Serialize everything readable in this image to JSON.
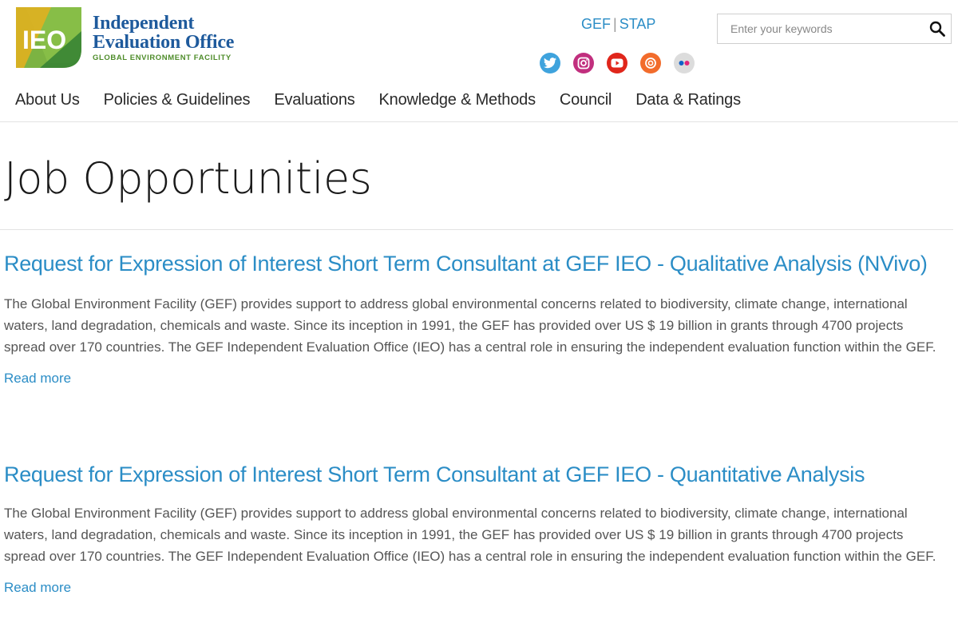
{
  "logo": {
    "mark_text": "IEO",
    "line1": "Independent",
    "line2": "Evaluation Office",
    "line3": "GLOBAL ENVIRONMENT FACILITY"
  },
  "top_links": {
    "gef": "GEF",
    "separator": "|",
    "stap": "STAP"
  },
  "social": [
    {
      "name": "twitter-icon",
      "color": "#3fa3dd"
    },
    {
      "name": "instagram-icon",
      "color": "#c12f7e"
    },
    {
      "name": "youtube-icon",
      "color": "#e0261b"
    },
    {
      "name": "issuu-icon",
      "color": "#f26c2c"
    },
    {
      "name": "flickr-icon",
      "color": "#dcdcdc"
    }
  ],
  "search": {
    "placeholder": "Enter your keywords",
    "value": ""
  },
  "nav": {
    "about": "About Us",
    "policies": "Policies & Guidelines",
    "evaluations": "Evaluations",
    "knowledge": "Knowledge & Methods",
    "council": "Council",
    "data": "Data & Ratings"
  },
  "page_title": "Job Opportunities",
  "articles": [
    {
      "title": "Request for Expression of Interest Short Term Consultant at GEF IEO - Qualitative Analysis (NVivo)",
      "body": "The Global Environment Facility (GEF) provides support to address global environmental concerns related to biodiversity, climate change, international waters, land degradation, chemicals and waste. Since its inception in 1991, the GEF has provided over US $ 19 billion in grants through 4700 projects spread over 170 countries. The GEF Independent Evaluation Office (IEO) has a central role in ensuring the independent evaluation function within the GEF.",
      "read_more": "Read more"
    },
    {
      "title": "Request for Expression of Interest Short Term Consultant at GEF IEO - Quantitative Analysis",
      "body": "The Global Environment Facility (GEF) provides support to address global environmental concerns related to biodiversity, climate change, international waters, land degradation, chemicals and waste. Since its inception in 1991, the GEF has provided over US $ 19 billion in grants through 4700 projects spread over 170 countries. The GEF Independent Evaluation Office (IEO) has a central role in ensuring the independent evaluation function within the GEF.",
      "read_more": "Read more"
    }
  ],
  "colors": {
    "link": "#2b8dc6",
    "logo_blue": "#1e5a9c",
    "logo_green": "#4e8c2a"
  }
}
